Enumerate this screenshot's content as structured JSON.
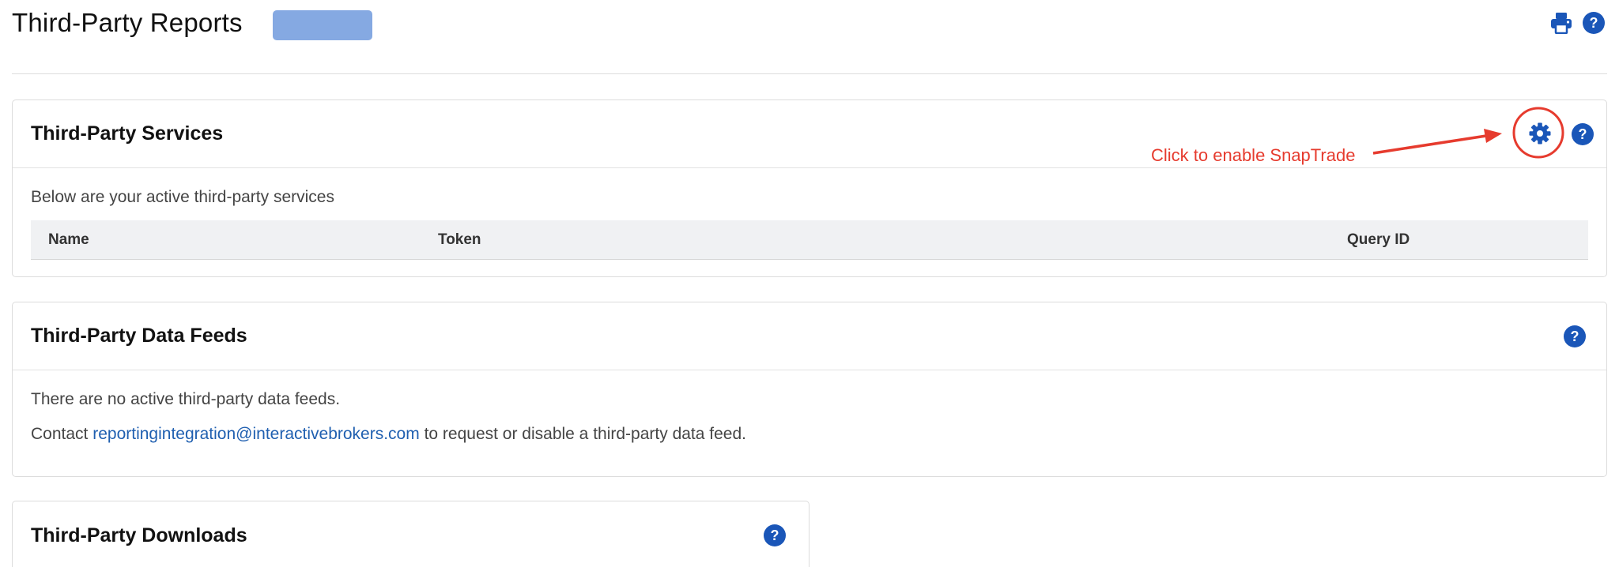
{
  "header": {
    "title": "Third-Party Reports",
    "account_badge_color": "#85a9e2",
    "print_icon": "print-icon",
    "help_icon": "help-icon"
  },
  "services": {
    "title": "Third-Party Services",
    "settings_icon": "gear-icon",
    "help_label": "?",
    "description": "Below are your active third-party services",
    "columns": [
      "Name",
      "Token",
      "Query ID"
    ]
  },
  "annotation": {
    "text": "Click to enable SnapTrade",
    "color": "#e63b2e"
  },
  "data_feeds": {
    "title": "Third-Party Data Feeds",
    "help_label": "?",
    "empty_text": "There are no active third-party data feeds.",
    "contact_prefix": "Contact ",
    "contact_email": "reportingintegration@interactivebrokers.com",
    "contact_suffix": " to request or disable a third-party data feed."
  },
  "downloads": {
    "title": "Third-Party Downloads",
    "help_label": "?"
  },
  "colors": {
    "accent": "#1a56b8",
    "link": "#1f5fb0"
  }
}
